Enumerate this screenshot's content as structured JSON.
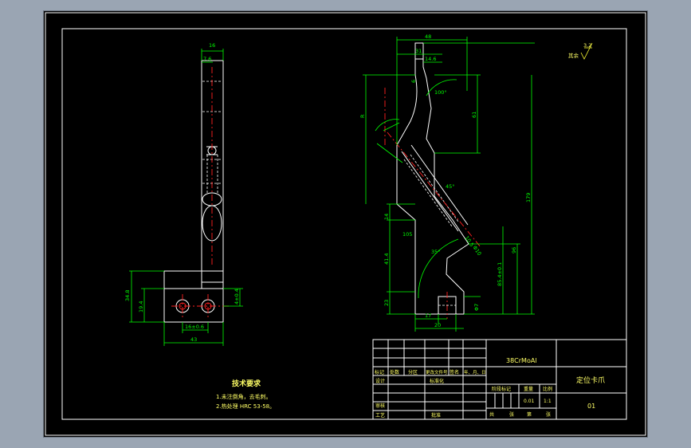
{
  "drawing": {
    "dims_left": {
      "d16": "16",
      "d7_6": "7.6",
      "d34_8": "34.8",
      "d19_4": "19.4",
      "d16_tol": "16±0.6",
      "d43": "43",
      "d4_tol": "4±0.4"
    },
    "dims_right": {
      "d48": "48",
      "d31": "31",
      "d14_6": "14.6",
      "d6": "6",
      "a100": "100°",
      "d61": "61",
      "dR": "R",
      "d179": "179",
      "d96": "96",
      "d85": "85.4±0.1",
      "d14": "14",
      "d41_4": "41.4",
      "d23": "23",
      "d17": "17",
      "d20": "20",
      "d71": "Φ7",
      "d35": "35°",
      "d105": "105",
      "d10_5": "10.5",
      "dphi10": "Φ10",
      "d45": "45°"
    },
    "roughness": {
      "label": "其余",
      "value": "3.2"
    },
    "tech": {
      "title": "技术要求",
      "line1": "1.未注倒角，去毛刺。",
      "line2": "2.热处理 HRC 53-58。"
    },
    "title_block": {
      "material": "38CrMoAl",
      "part_name": "定位卡爪",
      "part_no": "01",
      "scale": "1:1",
      "weight": "0.01",
      "header_row": [
        "标记",
        "处数",
        "分区",
        "更改文件号",
        "签名",
        "年、月、日"
      ],
      "design": "设计",
      "standard": "标准化",
      "review": "审核",
      "process": "工艺",
      "approve": "批准",
      "stage_label": "阶段标记",
      "weight_label": "重量",
      "scale_label": "比例",
      "sheets": "共",
      "sheet": "张",
      "sheet2": "第",
      "sheet3": "张"
    }
  }
}
